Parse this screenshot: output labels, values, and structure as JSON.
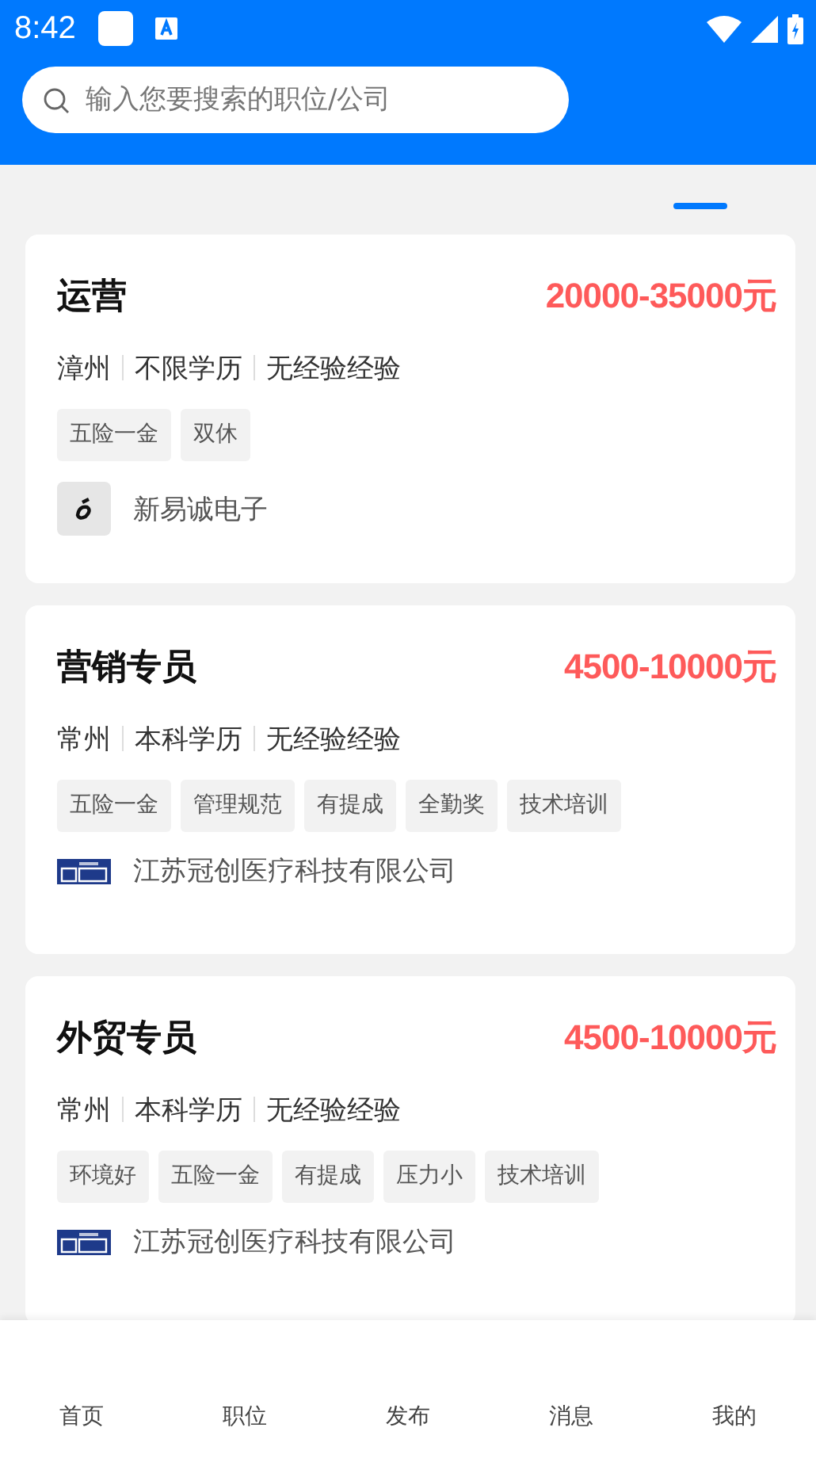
{
  "status_bar": {
    "time": "8:42"
  },
  "search": {
    "placeholder": "输入您要搜索的职位/公司"
  },
  "jobs": [
    {
      "title": "运营",
      "salary": "20000-35000元",
      "info": [
        "漳州",
        "不限学历",
        "无经验经验"
      ],
      "tags": [
        "五险一金",
        "双休"
      ],
      "company": "新易诚电子",
      "kind": "glyph"
    },
    {
      "title": "营销专员",
      "salary": "4500-10000元",
      "info": [
        "常州",
        "本科学历",
        "无经验经验"
      ],
      "tags": [
        "五险一金",
        "管理规范",
        "有提成",
        "全勤奖",
        "技术培训"
      ],
      "company": "江苏冠创医疗科技有限公司",
      "kind": "banner"
    },
    {
      "title": "外贸专员",
      "salary": "4500-10000元",
      "info": [
        "常州",
        "本科学历",
        "无经验经验"
      ],
      "tags": [
        "环境好",
        "五险一金",
        "有提成",
        "压力小",
        "技术培训"
      ],
      "company": "江苏冠创医疗科技有限公司",
      "kind": "banner"
    }
  ],
  "nav": [
    {
      "label": "首页"
    },
    {
      "label": "职位"
    },
    {
      "label": "发布"
    },
    {
      "label": "消息"
    },
    {
      "label": "我的"
    }
  ]
}
